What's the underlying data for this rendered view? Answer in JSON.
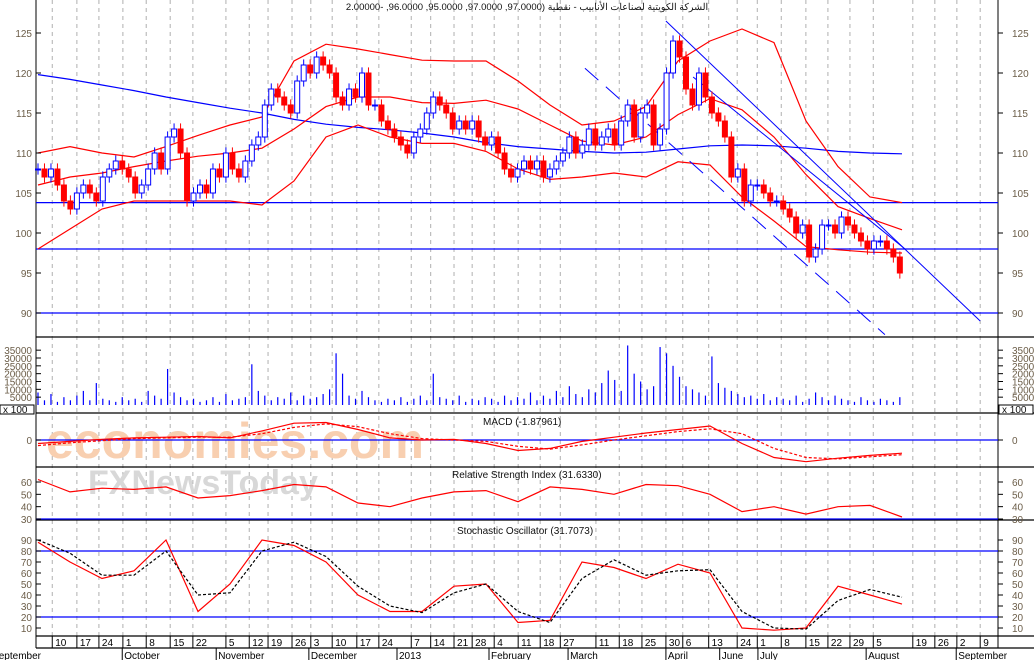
{
  "title": "الشركة الكويتية لصناعات الأنابيب - نقطية (97.0000, 97.0000, 95.0000, 96.0000, -2.00000",
  "watermarks": [
    "economies.com",
    "FXNewsToday"
  ],
  "colors": {
    "up": "#0000ff",
    "down": "#ff0000",
    "band": "#ff0000",
    "ma": "#0000ff",
    "trend": "#0000ff",
    "axis_text": "#6b5d48",
    "grid": "#b0b0b0"
  },
  "chart_data": {
    "type": "candlestick",
    "price": {
      "ylim": [
        87,
        127.5
      ],
      "yticks": [
        "125",
        "120",
        "115",
        "110",
        "105",
        "100",
        "95",
        "90"
      ],
      "closes": [
        108,
        107,
        108,
        106,
        104,
        103,
        105,
        106,
        105,
        104,
        107,
        108,
        109,
        108,
        107,
        105,
        106,
        108,
        110,
        108,
        112,
        113,
        110,
        104,
        105,
        106,
        105,
        108,
        107,
        110,
        108,
        107,
        109,
        111,
        112,
        116,
        118,
        117,
        116,
        115,
        119,
        121,
        120,
        122,
        121,
        120,
        117,
        116,
        118,
        117,
        120,
        116,
        116,
        114,
        113,
        112,
        111,
        110,
        112,
        113,
        115,
        117,
        116,
        115,
        113,
        114,
        113,
        114,
        112,
        111,
        112,
        110,
        108,
        107,
        108,
        109,
        108,
        109,
        107,
        108,
        109,
        110,
        112,
        110,
        111,
        113,
        111,
        112,
        113,
        111,
        114,
        116,
        112,
        115,
        116,
        111,
        113,
        120,
        124,
        122,
        118,
        116,
        120,
        117,
        115,
        114,
        112,
        107,
        108,
        104,
        106,
        106,
        105,
        104,
        104,
        103,
        102,
        100,
        101,
        97,
        98,
        101,
        101,
        100,
        102,
        101,
        100,
        99,
        98,
        99,
        99,
        98,
        97,
        95
      ],
      "bollinger_upper": [
        110,
        110.8,
        110,
        109.5,
        110.8,
        112.2,
        113.5,
        114.5,
        121.5,
        123.6,
        123,
        122.3,
        121.6,
        121.5,
        121.5,
        119,
        116,
        113.5,
        114,
        115.8,
        121.5,
        124,
        125.5,
        123.8,
        114,
        108.3,
        104.5,
        103.8
      ],
      "bollinger_mid": [
        106,
        107,
        107.5,
        108.3,
        109,
        109.6,
        110,
        110.6,
        113,
        115.8,
        117,
        117,
        116.3,
        116.2,
        116.6,
        115.5,
        113.5,
        111.5,
        111,
        112,
        114.8,
        116.8,
        115.4,
        112,
        107.3,
        103.3,
        101.8,
        100.4
      ],
      "bollinger_lower": [
        98,
        100.5,
        103,
        104,
        104,
        104,
        104,
        103.5,
        106.5,
        112,
        113.5,
        112,
        111.2,
        111.2,
        110.2,
        108,
        106.7,
        107,
        107.5,
        107,
        108.9,
        108.5,
        104.5,
        101.5,
        98.3,
        97.9,
        97.6,
        97.5
      ],
      "moving_average": [
        119.8,
        119.2,
        118.5,
        117.8,
        117,
        116.3,
        115.6,
        115,
        114.2,
        113.6,
        113.2,
        112.9,
        112.5,
        112,
        111.3,
        110.8,
        110.5,
        110.2,
        110,
        110.1,
        110.5,
        110.9,
        111,
        110.9,
        110.6,
        110.2,
        110,
        109.9
      ],
      "horizontal_lines": [
        103.8,
        98,
        90
      ],
      "trendlines": [
        {
          "style": "solid",
          "from": [
            96.9,
            126.5
          ],
          "to": [
            145.4,
            89
          ]
        },
        {
          "style": "solid",
          "from": [
            101.1,
            119.5
          ],
          "to": [
            133.8,
            98
          ]
        },
        {
          "style": "dashed",
          "from": [
            84.4,
            120.6
          ],
          "to": [
            130.7,
            87.3
          ]
        }
      ]
    },
    "volume": {
      "unit_label": "x 100",
      "yticks": [
        "35000",
        "30000",
        "25000",
        "20000",
        "15000",
        "10000",
        "5000"
      ],
      "values": [
        8000,
        3000,
        7000,
        2000,
        5000,
        3000,
        6000,
        9000,
        3000,
        14000,
        4000,
        3000,
        2000,
        5000,
        3000,
        4000,
        2000,
        9000,
        6000,
        4000,
        23000,
        8000,
        5000,
        3000,
        4000,
        2000,
        3000,
        5000,
        2000,
        7000,
        3000,
        4000,
        5000,
        26000,
        9000,
        6000,
        3000,
        5000,
        4000,
        8000,
        3000,
        6000,
        4000,
        5000,
        7000,
        10000,
        33000,
        20000,
        6000,
        4000,
        9000,
        5000,
        3000,
        2000,
        4000,
        3000,
        5000,
        2000,
        4000,
        6000,
        3000,
        20000,
        5000,
        4000,
        3000,
        6000,
        2000,
        4000,
        3000,
        5000,
        4000,
        2000,
        6000,
        3000,
        5000,
        4000,
        8000,
        3000,
        6000,
        4000,
        9000,
        5000,
        12000,
        7000,
        5000,
        10000,
        8000,
        14000,
        22000,
        16000,
        9000,
        38000,
        20000,
        15000,
        10000,
        12000,
        37000,
        33000,
        25000,
        18000,
        12000,
        10000,
        8000,
        6000,
        31000,
        14000,
        11000,
        9000,
        7000,
        5000,
        6000,
        4000,
        7000,
        3000,
        5000,
        4000,
        3000,
        6000,
        2000,
        4000,
        8000,
        5000,
        3000,
        6000,
        4000,
        3000,
        2000,
        5000,
        3000,
        2000,
        4000,
        3000,
        2000,
        5000
      ]
    },
    "macd": {
      "label": "MACD (-1.87961)",
      "yticks": [
        "0"
      ],
      "macd": [
        -0.5,
        -0.2,
        0.1,
        0.3,
        0.4,
        0.5,
        0.3,
        1.3,
        2.4,
        2.5,
        1.5,
        0.3,
        0,
        0.1,
        -0.5,
        -1.5,
        -1.2,
        -0.2,
        0.4,
        1.0,
        1.5,
        2.0,
        -0.5,
        -2.5,
        -3.1,
        -2.6,
        -2.2,
        -1.88
      ],
      "signal": [
        -0.8,
        -0.4,
        -0.1,
        0.2,
        0.3,
        0.4,
        0.4,
        0.9,
        1.8,
        2.3,
        1.9,
        0.9,
        0.2,
        0,
        -0.2,
        -0.9,
        -1.3,
        -0.7,
        0,
        0.6,
        1.2,
        1.6,
        0.9,
        -1.2,
        -2.5,
        -2.7,
        -2.4,
        -2.1
      ]
    },
    "rsi": {
      "label": "Relative Strength Index (31.6330)",
      "yticks": [
        "60",
        "50",
        "40",
        "30"
      ],
      "level": 30,
      "values": [
        62,
        52,
        55,
        54,
        56,
        47,
        49,
        53,
        58,
        56,
        43,
        40,
        47,
        52,
        53,
        44,
        56,
        54,
        50,
        58,
        57,
        50,
        36,
        40,
        34,
        40,
        41,
        31.6
      ]
    },
    "stochastic": {
      "label": "Stochastic Oscillator (31.7073)",
      "yticks": [
        "90",
        "80",
        "70",
        "60",
        "50",
        "40",
        "30",
        "20",
        "10"
      ],
      "levels": [
        80,
        20
      ],
      "k": [
        88,
        70,
        55,
        62,
        90,
        25,
        50,
        90,
        85,
        70,
        40,
        25,
        25,
        48,
        50,
        15,
        17,
        70,
        65,
        55,
        68,
        60,
        10,
        8,
        10,
        48,
        40,
        31.7
      ],
      "d": [
        90,
        78,
        58,
        58,
        80,
        40,
        42,
        80,
        88,
        75,
        48,
        30,
        24,
        42,
        50,
        25,
        15,
        55,
        72,
        58,
        62,
        63,
        25,
        10,
        9,
        35,
        45,
        38
      ]
    },
    "x_ticks": [
      {
        "label": "10",
        "idx": 2.2
      },
      {
        "label": "17",
        "idx": 6.0
      },
      {
        "label": "24",
        "idx": 9.4
      },
      {
        "label": "1",
        "idx": 13.1
      },
      {
        "label": "8",
        "idx": 16.7
      },
      {
        "label": "15",
        "idx": 20.4
      },
      {
        "label": "22",
        "idx": 23.9
      },
      {
        "label": "5",
        "idx": 29.0
      },
      {
        "label": "12",
        "idx": 32.6
      },
      {
        "label": "19",
        "idx": 35.5
      },
      {
        "label": "26",
        "idx": 39.2
      },
      {
        "label": "3",
        "idx": 42.1
      },
      {
        "label": "10",
        "idx": 45.4
      },
      {
        "label": "17",
        "idx": 49.2
      },
      {
        "label": "24",
        "idx": 52.6
      },
      {
        "label": "7",
        "idx": 57.6
      },
      {
        "label": "14",
        "idx": 60.6
      },
      {
        "label": "21",
        "idx": 64.2
      },
      {
        "label": "28",
        "idx": 67.0
      },
      {
        "label": "4",
        "idx": 70.4
      },
      {
        "label": "11",
        "idx": 74.1
      },
      {
        "label": "18",
        "idx": 77.5
      },
      {
        "label": "27",
        "idx": 80.6
      },
      {
        "label": "11",
        "idx": 86.1
      },
      {
        "label": "18",
        "idx": 89.7
      },
      {
        "label": "25",
        "idx": 93.2
      },
      {
        "label": "30",
        "idx": 96.9
      },
      {
        "label": "6",
        "idx": 99.5
      },
      {
        "label": "13",
        "idx": 103.5
      },
      {
        "label": "24",
        "idx": 107.9
      },
      {
        "label": "1",
        "idx": 111.0
      },
      {
        "label": "8",
        "idx": 114.7
      },
      {
        "label": "15",
        "idx": 118.5
      },
      {
        "label": "22",
        "idx": 121.9
      },
      {
        "label": "29",
        "idx": 125.3
      },
      {
        "label": "5",
        "idx": 128.9
      },
      {
        "label": "19",
        "idx": 135.0
      },
      {
        "label": "26",
        "idx": 138.4
      },
      {
        "label": "2",
        "idx": 141.8
      },
      {
        "label": "9",
        "idx": 145.4
      }
    ],
    "x_months": [
      {
        "label": "September",
        "idx": -7.4
      },
      {
        "label": "October",
        "idx": 13.0
      },
      {
        "label": "November",
        "idx": 27.5
      },
      {
        "label": "December",
        "idx": 41.8
      },
      {
        "label": "2013",
        "idx": 55.4
      },
      {
        "label": "February",
        "idx": 69.6
      },
      {
        "label": "March",
        "idx": 81.8
      },
      {
        "label": "April",
        "idx": 96.9
      },
      {
        "label": "June",
        "idx": 105.2
      },
      {
        "label": "July",
        "idx": 111.1
      },
      {
        "label": "August",
        "idx": 127.8
      },
      {
        "label": "September",
        "idx": 141.7
      }
    ]
  }
}
